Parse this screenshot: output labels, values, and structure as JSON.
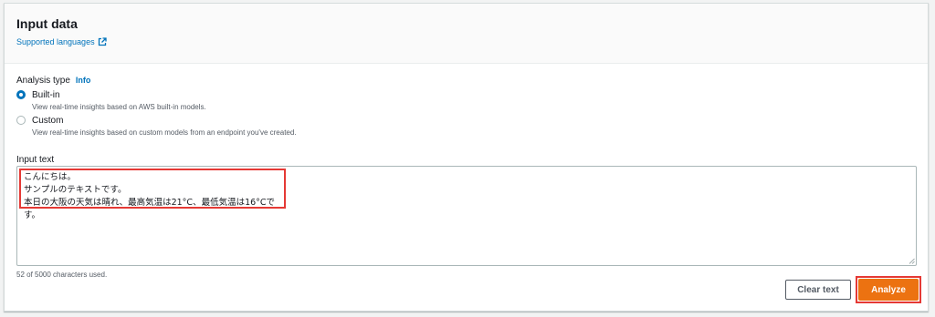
{
  "header": {
    "title": "Input data",
    "supported_languages_link": "Supported languages"
  },
  "analysis_type": {
    "label": "Analysis type",
    "info_link": "Info",
    "options": [
      {
        "title": "Built-in",
        "description": "View real-time insights based on AWS built-in models.",
        "selected": true
      },
      {
        "title": "Custom",
        "description": "View real-time insights based on custom models from an endpoint you've created.",
        "selected": false
      }
    ]
  },
  "input_text": {
    "label": "Input text",
    "lines": [
      "こんにちは。",
      "サンプルのテキストです。",
      "本日の大阪の天気は晴れ、最高気温は21°C、最低気温は16°Cです。"
    ],
    "char_count": "52 of 5000 characters used."
  },
  "actions": {
    "clear_label": "Clear text",
    "analyze_label": "Analyze"
  },
  "colors": {
    "accent": "#0073bb",
    "primary_button": "#ec7211",
    "highlight": "#e53935"
  }
}
